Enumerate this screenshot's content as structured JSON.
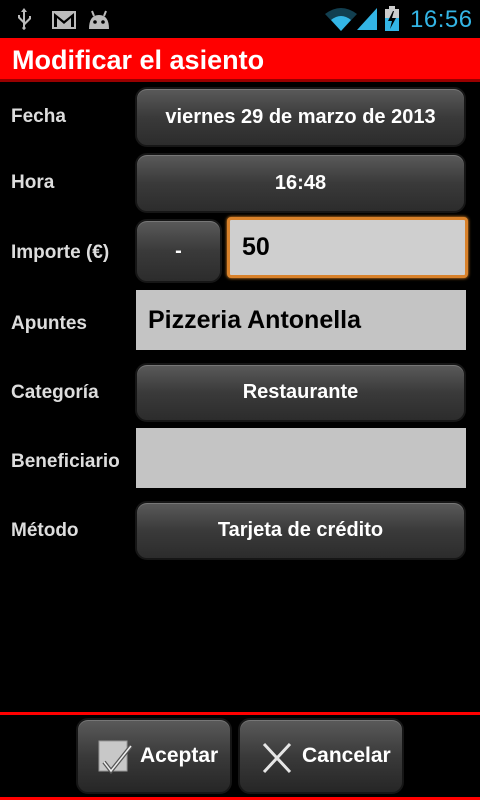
{
  "status_bar": {
    "time": "16:56",
    "icons": [
      "usb-icon",
      "gmail-icon",
      "android-icon",
      "wifi-icon",
      "signal-icon",
      "battery-charging-icon"
    ]
  },
  "title": "Modificar el asiento",
  "form": {
    "fecha": {
      "label": "Fecha",
      "value": "viernes 29 de marzo de 2013"
    },
    "hora": {
      "label": "Hora",
      "value": "16:48"
    },
    "importe": {
      "label": "Importe (€)",
      "sign": "-",
      "value": "50"
    },
    "apuntes": {
      "label": "Apuntes",
      "value": "Pizzeria Antonella"
    },
    "categoria": {
      "label": "Categoría",
      "value": "Restaurante"
    },
    "beneficiario": {
      "label": "Beneficiario",
      "value": ""
    },
    "metodo": {
      "label": "Método",
      "value": "Tarjeta de crédito"
    }
  },
  "actions": {
    "accept_label": "Aceptar",
    "cancel_label": "Cancelar"
  },
  "colors": {
    "accent": "#ff0000",
    "clock": "#33b5e5",
    "focus": "#d9822b"
  }
}
